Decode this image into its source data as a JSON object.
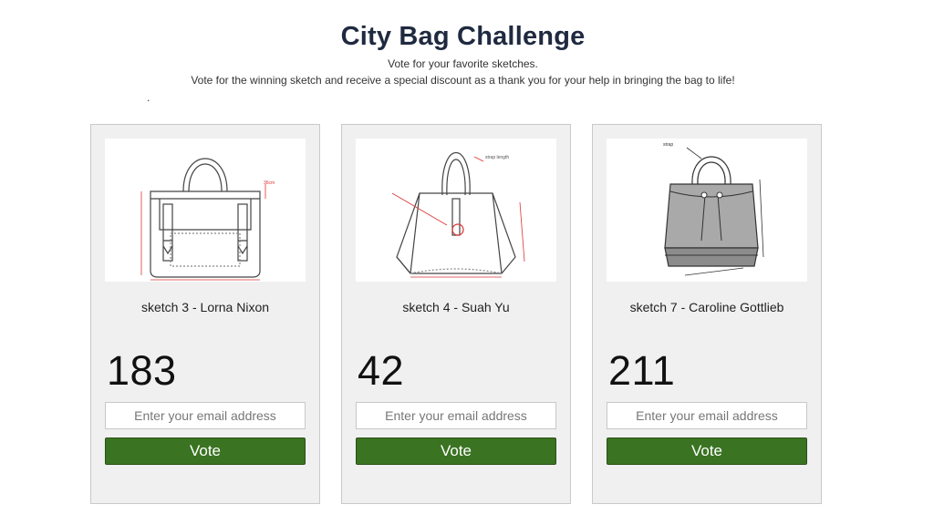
{
  "header": {
    "title": "City Bag Challenge",
    "subtitle_1": "Vote for your favorite sketches.",
    "subtitle_2": "Vote for the winning sketch and receive a special discount as a thank you for your help in bringing the bag to life!",
    "dot": "."
  },
  "cards": [
    {
      "label": "sketch 3 - Lorna Nixon",
      "votes": "183",
      "email_placeholder": "Enter your email address",
      "button": "Vote"
    },
    {
      "label": "sketch 4 - Suah Yu",
      "votes": "42",
      "email_placeholder": "Enter your email address",
      "button": "Vote"
    },
    {
      "label": "sketch 7 - Caroline Gottlieb",
      "votes": "211",
      "email_placeholder": "Enter your email address",
      "button": "Vote"
    }
  ]
}
